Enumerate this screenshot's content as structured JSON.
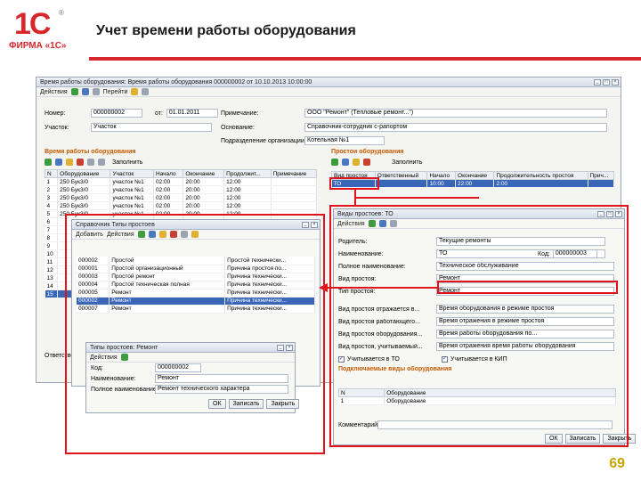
{
  "slide": {
    "logo_mark": "1С",
    "logo_reg": "®",
    "logo_firm": "ФИРМА «1С»",
    "title": "Учет времени работы оборудования",
    "page_number": "69"
  },
  "colors": {
    "accent_red": "#d7262c",
    "selection_blue": "#3a66b8",
    "page_number": "#c8a400"
  },
  "main_window": {
    "title": "Время работы оборудования: Время работы оборудования 000000002 от 10.10.2013 10:00:00",
    "toolbar": {
      "actions_label": "Действия",
      "goto_label": "Перейти"
    },
    "fields": {
      "number_label": "Номер:",
      "number_value": "000000002",
      "from_label": "от:",
      "date_value": "01.01.2011",
      "division_label": "Участок:",
      "division_value": "Участок",
      "note_label": "Примечание:",
      "note_value": "ООО \"Ремонт\" (Тепловые ремонт...\")",
      "reason_label": "Основание:",
      "reason_value": "Справочник-сотрудник с-рапортом",
      "dept_label": "Подразделение организации:",
      "dept_value": "Котельная №1"
    },
    "left_section": {
      "title": "Время работы оборудования",
      "fill_label": "Заполнить",
      "columns": [
        "N",
        "Оборудование",
        "Участок",
        "Начало",
        "Окончание",
        "Продолжит...",
        "Примечание"
      ],
      "rows": [
        [
          "1",
          "250 Бук3/0",
          "участок №1",
          "02:00",
          "20:00",
          "12:00",
          ""
        ],
        [
          "2",
          "250 Бук3/0",
          "участок №1",
          "02:00",
          "20:00",
          "12:00",
          ""
        ],
        [
          "3",
          "250 Бук3/0",
          "участок №1",
          "02:00",
          "20:00",
          "12:00",
          ""
        ],
        [
          "4",
          "250 Бук3/0",
          "участок №1",
          "02:00",
          "20:00",
          "12:00",
          ""
        ],
        [
          "5",
          "250 Бук3/0",
          "участок №1",
          "02:00",
          "20:00",
          "12:00",
          ""
        ],
        [
          "6",
          "",
          "",
          "",
          "",
          "",
          ""
        ],
        [
          "7",
          "",
          "",
          "",
          "",
          "",
          ""
        ],
        [
          "8",
          "",
          "",
          "",
          "",
          "",
          ""
        ],
        [
          "9",
          "",
          "",
          "",
          "",
          "",
          ""
        ],
        [
          "10",
          "",
          "",
          "",
          "",
          "",
          ""
        ],
        [
          "11",
          "",
          "",
          "",
          "",
          "",
          ""
        ],
        [
          "12",
          "",
          "",
          "",
          "",
          "",
          ""
        ],
        [
          "13",
          "",
          "",
          "",
          "",
          "",
          ""
        ],
        [
          "14",
          "",
          "",
          "",
          "",
          "",
          ""
        ],
        [
          "15",
          "",
          "",
          "",
          "",
          "",
          ""
        ]
      ],
      "responsible_label": "Ответственный:"
    },
    "right_section": {
      "title": "Простои оборудования",
      "fill_label": "Заполнить",
      "columns": [
        "Вид простоя",
        "Ответственный",
        "Начало",
        "Окончание",
        "Продолжительность простоя",
        "Прич..."
      ],
      "rows": [
        [
          "ТО",
          "",
          "10:00",
          "22:00",
          "2:00",
          ""
        ]
      ]
    }
  },
  "catalog_window": {
    "title": "Справочник Типы простоев",
    "toolbar": {
      "add_label": "Добавить",
      "actions_label": "Действия"
    },
    "rows": [
      {
        "code": "000002",
        "name": "Простой",
        "desc": "Простой технически..."
      },
      {
        "code": "000001",
        "name": "Простой организационный",
        "desc": "Причина простоя по..."
      },
      {
        "code": "000003",
        "name": "Простой ремонт",
        "desc": "Причина технически..."
      },
      {
        "code": "000004",
        "name": "Простой техническая полная",
        "desc": "Причина технически..."
      },
      {
        "code": "000005",
        "name": "Ремонт",
        "desc": "Причина технически..."
      },
      {
        "code": "000002",
        "name": "Ремонт",
        "desc": "Причина технически..."
      },
      {
        "code": "000007",
        "name": "Ремонт",
        "desc": "Причина технически..."
      }
    ]
  },
  "type_dialog": {
    "title": "Типы простоев: Ремонт",
    "actions_label": "Действия",
    "code_label": "Код:",
    "code_value": "000000002",
    "name_label": "Наименование:",
    "name_value": "Ремонт",
    "fullname_label": "Полное наименование:",
    "fullname_value": "Ремонт технического характера",
    "ok_label": "ОК",
    "save_label": "Записать",
    "close_label": "Закрыть"
  },
  "downtime_dialog": {
    "title": "Виды простоев: ТО",
    "actions_label": "Действия",
    "fields": [
      {
        "label": "Родитель:",
        "value": "Текущие ремонты"
      },
      {
        "label": "Наименование:",
        "value": "ТО"
      },
      {
        "label": "Полное наименование:",
        "value": "Техническое обслуживание"
      },
      {
        "label": "Вид простоя:",
        "value": "Ремонт"
      },
      {
        "label": "Тип простоя:",
        "value": "Ремонт"
      },
      {
        "label": "Вид простоя отражается в...",
        "value": "Время оборудования в режиме простоя"
      },
      {
        "label": "Вид простоя работающего...",
        "value": "Время отражения в режиме простоя"
      },
      {
        "label": "Вид простоя оборудования...",
        "value": "Время работы оборудования по..."
      },
      {
        "label": "Вид простоя, учитываемый...",
        "value": "Время отражения время работы оборудования"
      }
    ],
    "code_label": "Код:",
    "code_value": "000000003",
    "flag1_label": "Учитывается в ТО",
    "flag2_label": "Учитывается в КИП",
    "equipment_label": "Подключаемые виды оборудования",
    "table_columns": [
      "N",
      "Оборудование"
    ],
    "table_rows": [
      [
        "1",
        "Оборудование"
      ]
    ],
    "comment_label": "Комментарий:",
    "ok_label": "ОК",
    "save_label": "Записать",
    "close_label": "Закрыть"
  }
}
